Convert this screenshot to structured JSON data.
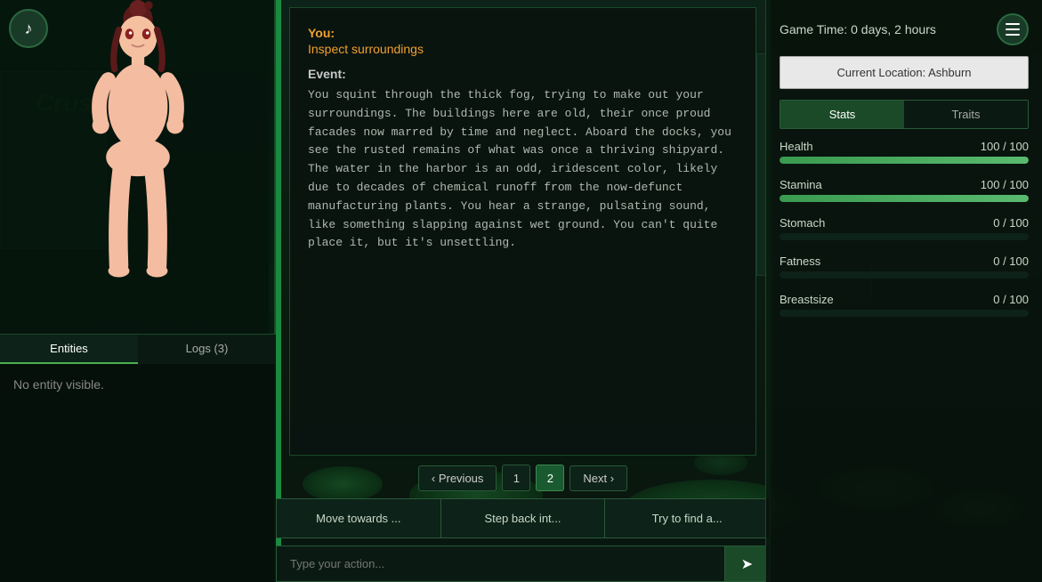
{
  "header": {
    "game_time": "Game Time: 0 days, 2 hours",
    "location": "Current Location: Ashburn",
    "menu_label": "menu"
  },
  "music_icon": "♪",
  "stats": {
    "tab_stats": "Stats",
    "tab_traits": "Traits",
    "health_label": "Health",
    "health_value": "100 / 100",
    "health_pct": 100,
    "stamina_label": "Stamina",
    "stamina_value": "100 / 100",
    "stamina_pct": 100,
    "stomach_label": "Stomach",
    "stomach_value": "0 / 100",
    "stomach_pct": 0,
    "fatness_label": "Fatness",
    "fatness_value": "0 / 100",
    "fatness_pct": 0,
    "breastsize_label": "Breastsize",
    "breastsize_value": "0 / 100",
    "breastsize_pct": 0
  },
  "story": {
    "you_label": "You:",
    "action": "Inspect surroundings",
    "event_label": "Event:",
    "text": "You squint through the thick fog, trying to make out your surroundings. The buildings here are old, their once proud facades now marred by time and neglect. Aboard the docks, you see the rusted remains of what was once a thriving shipyard. The water in the harbor is an odd, iridescent color, likely due to decades of chemical runoff from the now-defunct manufacturing plants. You hear a strange, pulsating sound, like something slapping against wet ground. You can't quite place it, but it's unsettling."
  },
  "pagination": {
    "prev_label": "‹ Previous",
    "next_label": "Next ›",
    "page1": "1",
    "page2": "2",
    "active_page": 2
  },
  "actions": {
    "btn1": "Move towards ...",
    "btn2": "Step back int...",
    "btn3": "Try to find a..."
  },
  "input": {
    "placeholder": "Type your action...",
    "send_icon": "➤"
  },
  "entities": {
    "tab_entities": "Entities",
    "tab_logs": "Logs (3)",
    "no_entity": "No entity visible."
  },
  "sign": "Crus"
}
